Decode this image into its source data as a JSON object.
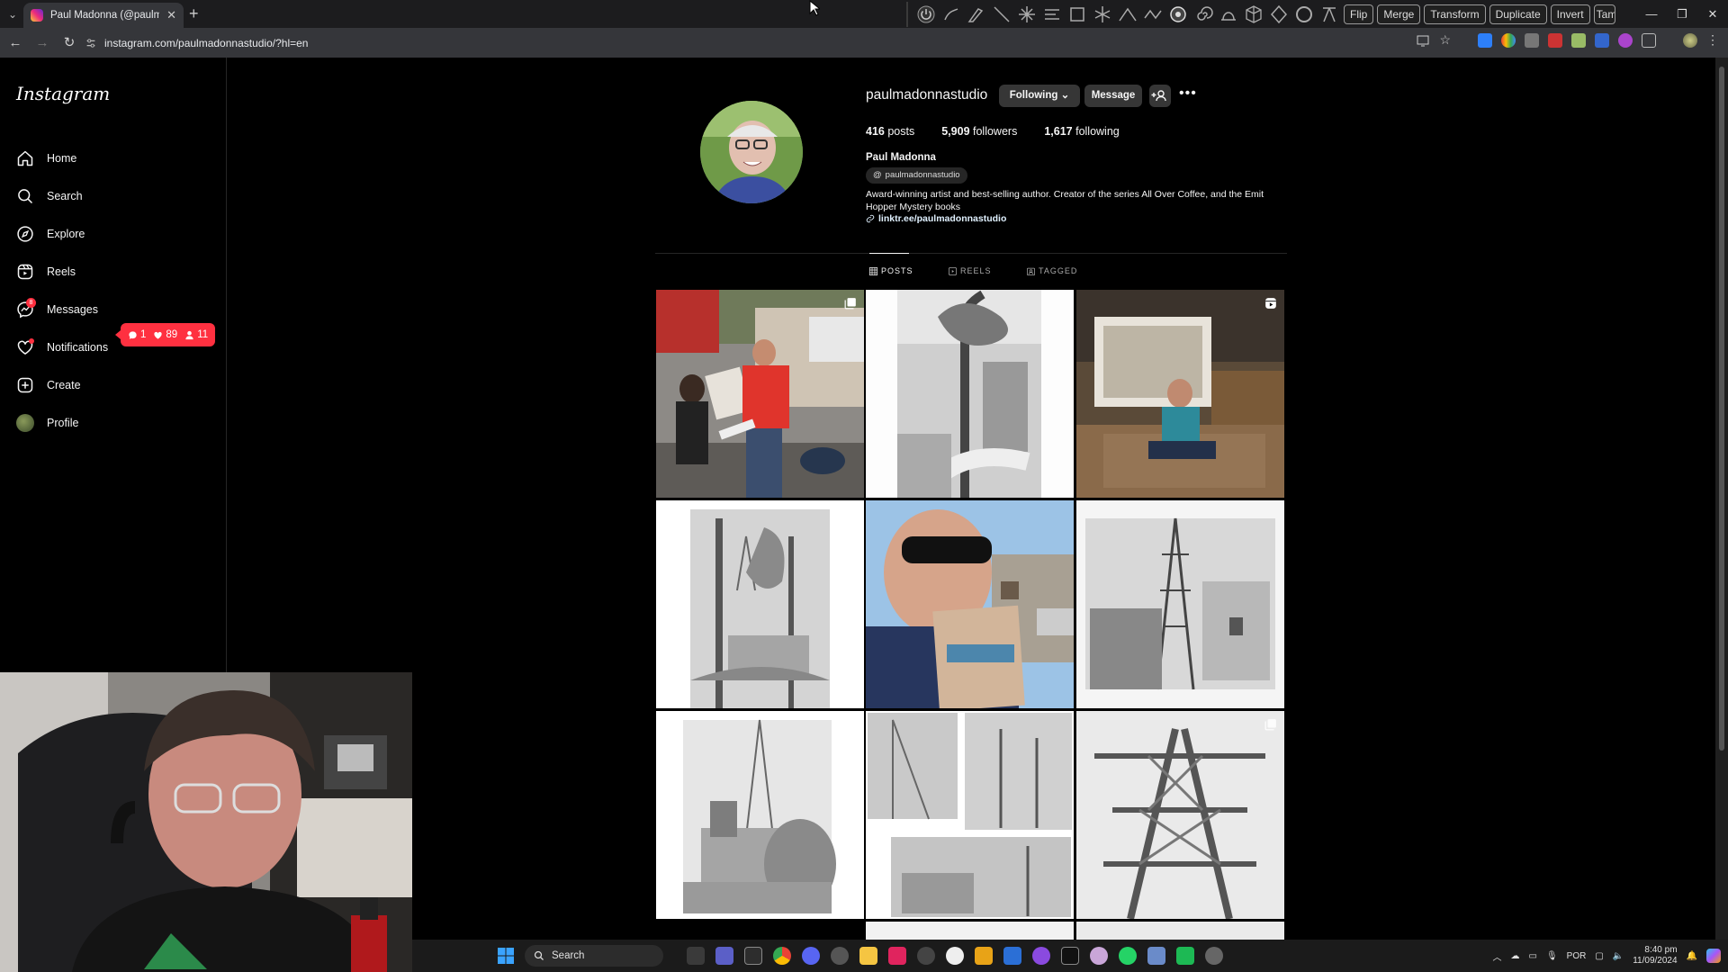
{
  "browser": {
    "tab_title": "Paul Madonna (@paulmadonn…",
    "url": "instagram.com/paulmadonnastudio/?hl=en",
    "toolbar_buttons": [
      "Flip",
      "Merge",
      "Transform",
      "Duplicate",
      "Invert",
      "Tam"
    ],
    "tabstrip_icons": [
      "tab-search-icon",
      "close-icon",
      "new-tab-icon"
    ],
    "window_icons": [
      "minimize-icon",
      "restore-icon",
      "close-icon"
    ]
  },
  "sidebar": {
    "logo": "Instagram",
    "items": [
      {
        "label": "Home",
        "icon": "home-icon"
      },
      {
        "label": "Search",
        "icon": "search-icon"
      },
      {
        "label": "Explore",
        "icon": "explore-icon"
      },
      {
        "label": "Reels",
        "icon": "reels-icon"
      },
      {
        "label": "Messages",
        "icon": "messenger-icon",
        "badge": "8"
      },
      {
        "label": "Notifications",
        "icon": "heart-icon"
      },
      {
        "label": "Create",
        "icon": "create-icon"
      },
      {
        "label": "Profile",
        "icon": "avatar"
      }
    ],
    "notification_pill": {
      "comments": "1",
      "likes": "89",
      "follows": "11"
    }
  },
  "profile": {
    "username": "paulmadonnastudio",
    "following_button": "Following",
    "message_button": "Message",
    "stats": {
      "posts": "416",
      "posts_label": "posts",
      "followers": "5,909",
      "followers_label": "followers",
      "following": "1,617",
      "following_label": "following"
    },
    "full_name": "Paul Madonna",
    "threads_handle": "paulmadonnastudio",
    "bio": "Award-winning artist and best-selling author. Creator of the series All Over Coffee, and the Emit Hopper Mystery books",
    "link": "linktr.ee/paulmadonnastudio",
    "tabs": [
      "POSTS",
      "REELS",
      "TAGGED"
    ]
  },
  "posts": [
    {
      "icon": "carousel-icon"
    },
    {
      "icon": ""
    },
    {
      "icon": "reel-icon"
    },
    {
      "icon": ""
    },
    {
      "icon": ""
    },
    {
      "icon": ""
    },
    {
      "icon": ""
    },
    {
      "icon": ""
    },
    {
      "icon": "carousel-icon"
    }
  ],
  "taskbar": {
    "search_label": "Search",
    "language": "POR",
    "time": "8:40 pm",
    "date": "11/09/2024"
  },
  "colors": {
    "notification_red": "#ff3040",
    "link_blue": "#e0f1ff",
    "button_gray": "#363636"
  }
}
